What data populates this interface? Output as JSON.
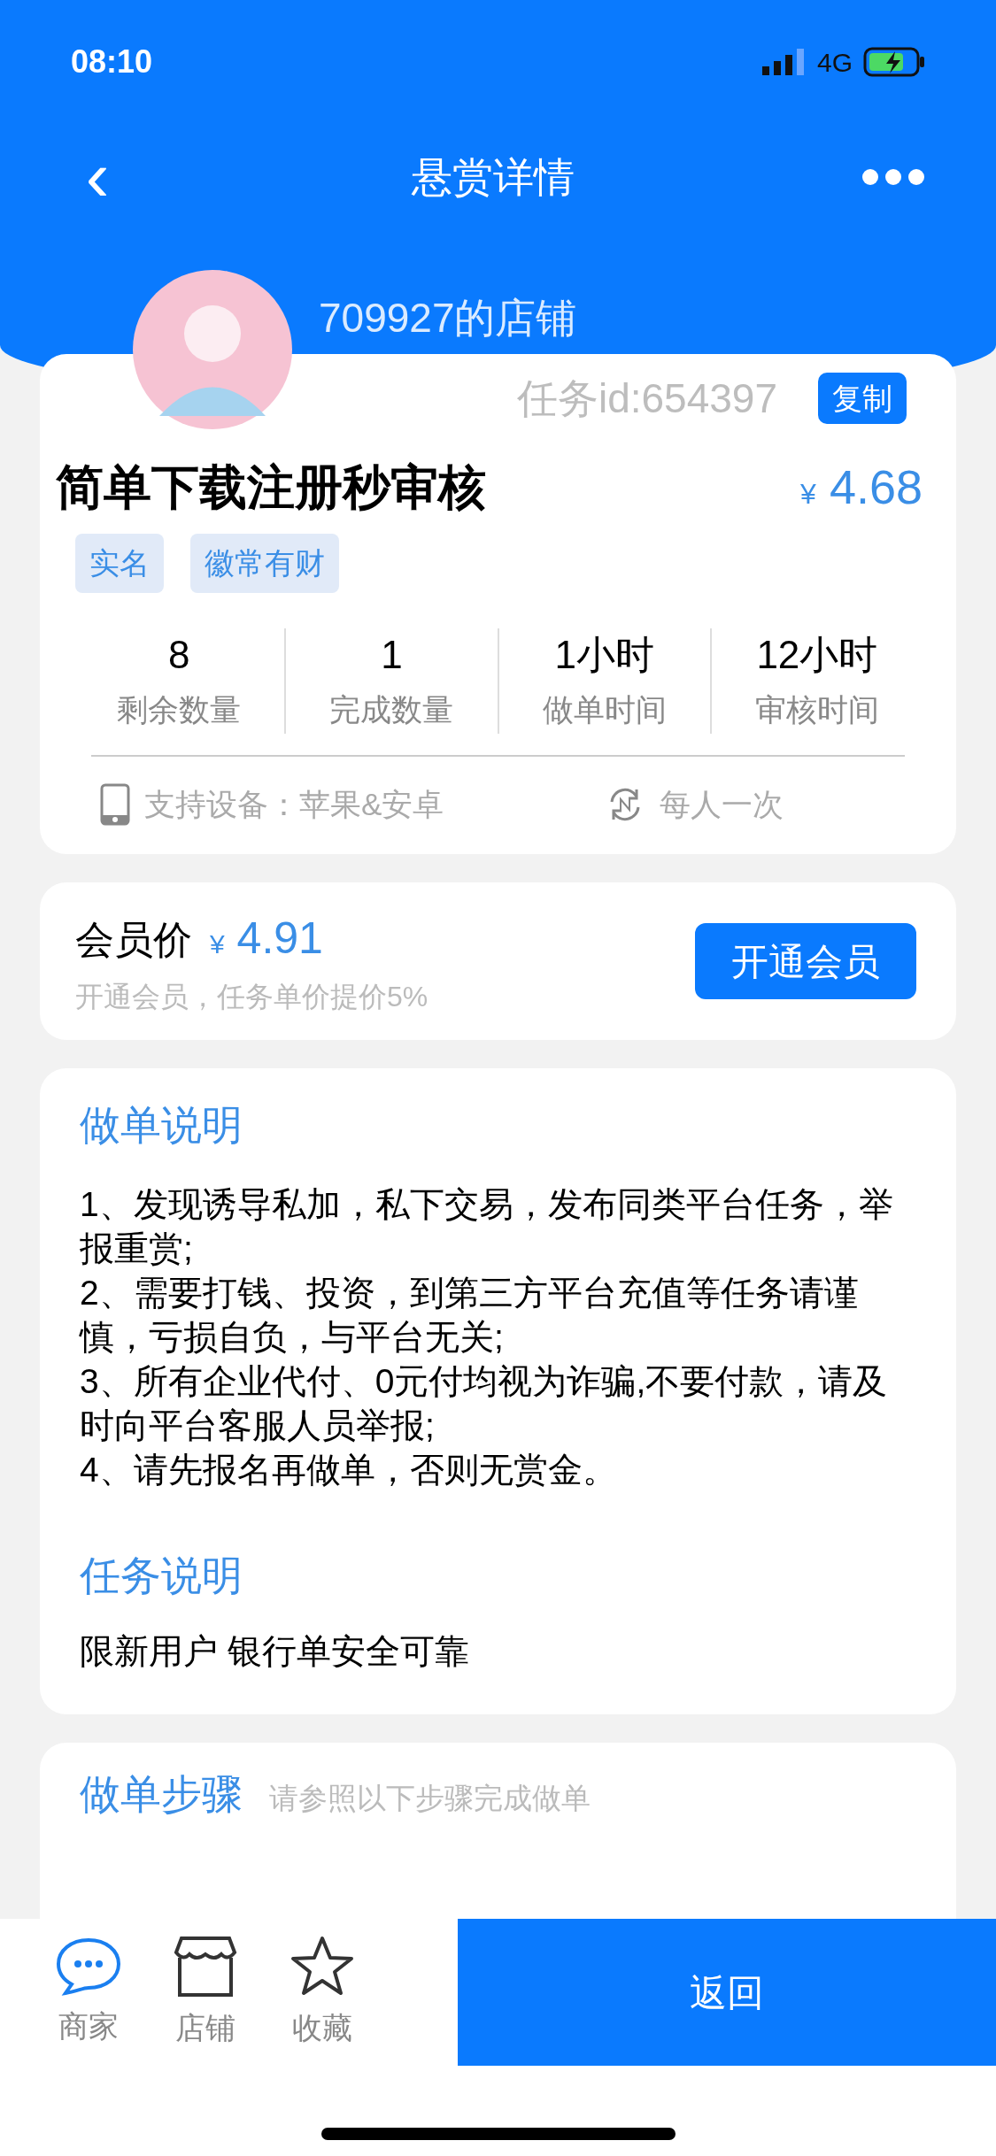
{
  "status_bar": {
    "time": "08:10",
    "network": "4G"
  },
  "nav": {
    "back": "‹",
    "title": "悬赏详情"
  },
  "shop": {
    "name": "709927的店铺",
    "task_id": "任务id:654397",
    "copy": "复制"
  },
  "task": {
    "title": "简单下载注册秒审核",
    "currency": "¥",
    "price": "4.68",
    "tags": [
      "实名",
      "徽常有财"
    ]
  },
  "stats": [
    {
      "value": "8",
      "label": "剩余数量"
    },
    {
      "value": "1",
      "label": "完成数量"
    },
    {
      "value": "1小时",
      "label": "做单时间"
    },
    {
      "value": "12小时",
      "label": "审核时间"
    }
  ],
  "support": {
    "devices": "支持设备：苹果&安卓",
    "frequency": "每人一次"
  },
  "member": {
    "label": "会员价",
    "currency": "¥",
    "price": "4.91",
    "note": "开通会员，任务单价提价5%",
    "button": "开通会员"
  },
  "instructions": {
    "title": "做单说明",
    "lines": [
      "1、发现诱导私加，私下交易，发布同类平台任务，举报重赏;",
      "2、需要打钱、投资，到第三方平台充值等任务请谨慎，亏损自负，与平台无关;",
      "3、所有企业代付、0元付均视为诈骗,不要付款，请及时向平台客服人员举报;",
      "4、请先报名再做单，否则无赏金。"
    ]
  },
  "task_description": {
    "title": "任务说明",
    "text": "限新用户 银行单安全可靠"
  },
  "steps": {
    "title": "做单步骤",
    "hint": "请参照以下步骤完成做单"
  },
  "bottom_bar": {
    "items": [
      {
        "label": "商家",
        "kind": "chat"
      },
      {
        "label": "店铺",
        "kind": "store"
      },
      {
        "label": "收藏",
        "kind": "star"
      }
    ],
    "back": "返回"
  }
}
